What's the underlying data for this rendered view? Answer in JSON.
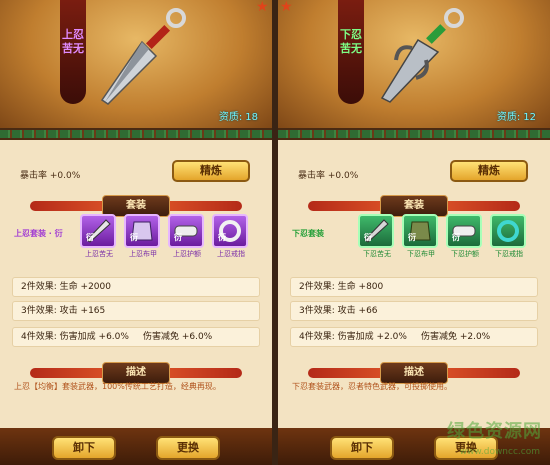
{
  "panels": [
    {
      "banner": "上忍苦无",
      "stat_label": "资质:",
      "stat_value": "18",
      "crit": "暴击率 +0.0%",
      "refine_label": "精炼",
      "set_section": "套装",
      "set_name": "上忍套装 · 衍",
      "pieces": [
        {
          "label": "上忍苦无",
          "glyph": "衍",
          "icon": "kunai-icon"
        },
        {
          "label": "上忍布甲",
          "glyph": "衍",
          "icon": "armor-icon"
        },
        {
          "label": "上忍护额",
          "glyph": "衍",
          "icon": "headband-icon"
        },
        {
          "label": "上忍戒指",
          "glyph": "衍",
          "icon": "ring-icon"
        }
      ],
      "effects": {
        "two": [
          "2件效果:",
          "生命",
          "+2000"
        ],
        "three": [
          "3件效果:",
          "攻击",
          "+165"
        ],
        "four": [
          "4件效果:",
          "伤害加成",
          "+6.0%",
          "伤害减免",
          "+6.0%"
        ]
      },
      "desc_section": "描述",
      "description": "上忍【均衡】套装武器，100%传统工艺打造，经典再现。",
      "btn_unequip": "卸下",
      "btn_swap": "更换",
      "color_rarity": "#9b3fd8"
    },
    {
      "banner": "下忍苦无",
      "stat_label": "资质:",
      "stat_value": "12",
      "crit": "暴击率 +0.0%",
      "refine_label": "精炼",
      "set_section": "套装",
      "set_name": "下忍套装",
      "pieces": [
        {
          "label": "下忍苦无",
          "glyph": "衍",
          "icon": "kunai-icon"
        },
        {
          "label": "下忍布甲",
          "glyph": "衍",
          "icon": "armor-icon"
        },
        {
          "label": "下忍护额",
          "glyph": "衍",
          "icon": "headband-icon"
        },
        {
          "label": "下忍戒指",
          "glyph": "",
          "icon": "ring-icon"
        }
      ],
      "effects": {
        "two": [
          "2件效果:",
          "生命",
          "+800"
        ],
        "three": [
          "3件效果:",
          "攻击",
          "+66"
        ],
        "four": [
          "4件效果:",
          "伤害加成",
          "+2.0%",
          "伤害减免",
          "+2.0%"
        ]
      },
      "desc_section": "描述",
      "description": "下忍套装武器，忍者特色武器，可投掷使用。",
      "btn_unequip": "卸下",
      "btn_swap": "更换",
      "color_rarity": "#2fae48"
    }
  ],
  "watermark": {
    "text": "绿色资源网",
    "url": "www.downcc.com"
  }
}
